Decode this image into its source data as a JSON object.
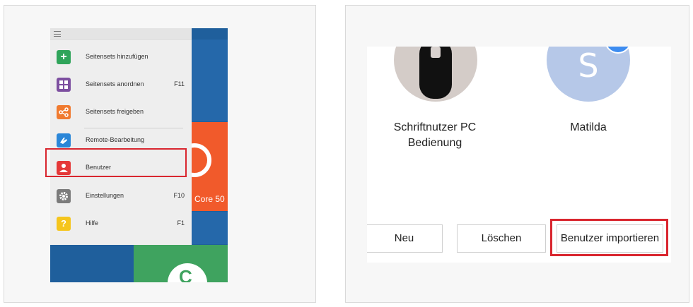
{
  "left": {
    "menu": {
      "items": [
        {
          "label": "Seitensets hinzufügen",
          "shortcut": "",
          "icon": "plus-icon",
          "color": "#2fa45a"
        },
        {
          "label": "Seitensets anordnen",
          "shortcut": "F11",
          "icon": "grid-icon",
          "color": "#7d4fa0"
        },
        {
          "label": "Seitensets freigeben",
          "shortcut": "",
          "icon": "share-icon",
          "color": "#f07a2f"
        },
        {
          "label": "Remote-Bearbeitung",
          "shortcut": "",
          "icon": "remote-hand-icon",
          "color": "#2a86d8"
        },
        {
          "label": "Benutzer",
          "shortcut": "",
          "icon": "user-icon",
          "color": "#e53838"
        },
        {
          "label": "Einstellungen",
          "shortcut": "F10",
          "icon": "gear-icon",
          "color": "#7b7b7b"
        },
        {
          "label": "Hilfe",
          "shortcut": "F1",
          "icon": "question-icon",
          "color": "#f5c51c"
        }
      ]
    },
    "tiles": {
      "core_label": "Core 50",
      "c_letter": "C"
    }
  },
  "right": {
    "users": [
      {
        "name_line1": "Schriftnutzer PC",
        "name_line2": "Bedienung"
      },
      {
        "name_line1": "Matilda",
        "name_line2": "",
        "initial": "S"
      }
    ],
    "buttons": {
      "new": "Neu",
      "delete": "Löschen",
      "import": "Benutzer importieren"
    }
  }
}
